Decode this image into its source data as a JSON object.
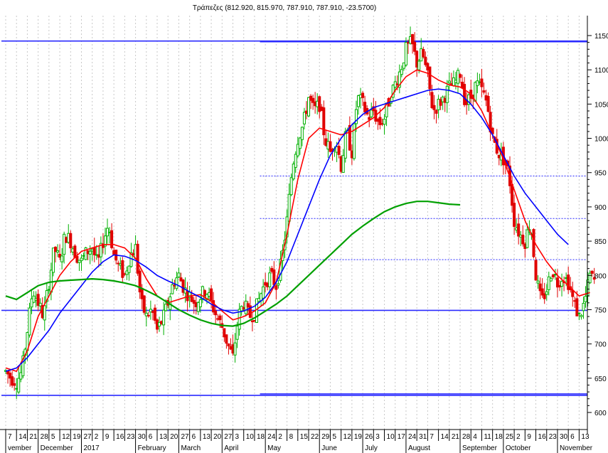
{
  "title": "Τράπεζες (812.920, 815.970, 787.910, 787.910, -23.5700)",
  "chart_data": {
    "type": "candlestick",
    "title": "Τράπεζες (812.920, 815.970, 787.910, 787.910, -23.5700)",
    "ohlc_last": {
      "open": 812.92,
      "high": 815.97,
      "low": 787.91,
      "close": 787.91,
      "change": -23.57
    },
    "ylim": [
      585,
      1165
    ],
    "y_ticks": [
      600,
      650,
      700,
      750,
      800,
      850,
      900,
      950,
      1000,
      1050,
      1100,
      1150
    ],
    "grid": true,
    "x_day_labels": [
      "7",
      "14",
      "21",
      "28",
      "5",
      "12",
      "19",
      "27",
      "2",
      "9",
      "16",
      "23",
      "30",
      "6",
      "13",
      "20",
      "27",
      "6",
      "13",
      "20",
      "27",
      "3",
      "10",
      "18",
      "24",
      "2",
      "8",
      "15",
      "22",
      "29",
      "5",
      "12",
      "19",
      "26",
      "3",
      "10",
      "17",
      "24",
      "31",
      "7",
      "14",
      "21",
      "28",
      "4",
      "11",
      "18",
      "25",
      "2",
      "9",
      "16",
      "23",
      "30",
      "6",
      "13"
    ],
    "x_month_labels": [
      {
        "label": "vember",
        "after_day_index": 0
      },
      {
        "label": "December",
        "after_day_index": 3
      },
      {
        "label": "2017",
        "after_day_index": 7
      },
      {
        "label": "February",
        "after_day_index": 12
      },
      {
        "label": "March",
        "after_day_index": 16
      },
      {
        "label": "April",
        "after_day_index": 20
      },
      {
        "label": "May",
        "after_day_index": 24
      },
      {
        "label": "June",
        "after_day_index": 29
      },
      {
        "label": "July",
        "after_day_index": 33
      },
      {
        "label": "August",
        "after_day_index": 37
      },
      {
        "label": "September",
        "after_day_index": 42
      },
      {
        "label": "October",
        "after_day_index": 46
      },
      {
        "label": "November",
        "after_day_index": 51
      }
    ],
    "horizontal_levels": [
      {
        "value": 1142,
        "style": "solid",
        "start_week": 0
      },
      {
        "value": 1141,
        "style": "solid",
        "start_week": 23.5
      },
      {
        "value": 945,
        "style": "dotted",
        "start_week": 23.5
      },
      {
        "value": 883,
        "style": "dotted",
        "start_week": 23.5
      },
      {
        "value": 823,
        "style": "dotted",
        "start_week": 23.5
      },
      {
        "value": 749,
        "style": "solid",
        "start_week": 0
      },
      {
        "value": 625,
        "style": "solid",
        "start_week": 0
      },
      {
        "value": 627,
        "style": "solid",
        "start_week": 23.5
      }
    ],
    "candle_anchors": [
      [
        0,
        660
      ],
      [
        0.5,
        650
      ],
      [
        1,
        645
      ],
      [
        1.5,
        660
      ],
      [
        2,
        720
      ],
      [
        2.5,
        780
      ],
      [
        3,
        760
      ],
      [
        3.5,
        740
      ],
      [
        4,
        790
      ],
      [
        4.5,
        840
      ],
      [
        5,
        820
      ],
      [
        5.5,
        860
      ],
      [
        6,
        850
      ],
      [
        6.5,
        830
      ],
      [
        7,
        820
      ],
      [
        7.5,
        835
      ],
      [
        8,
        840
      ],
      [
        8.5,
        815
      ],
      [
        9,
        850
      ],
      [
        9.5,
        875
      ],
      [
        10,
        830
      ],
      [
        10.5,
        810
      ],
      [
        11,
        800
      ],
      [
        11.5,
        830
      ],
      [
        12,
        840
      ],
      [
        12.5,
        760
      ],
      [
        13,
        740
      ],
      [
        13.5,
        750
      ],
      [
        14,
        720
      ],
      [
        14.5,
        735
      ],
      [
        15,
        760
      ],
      [
        15.5,
        790
      ],
      [
        16,
        800
      ],
      [
        16.5,
        780
      ],
      [
        17,
        770
      ],
      [
        17.5,
        760
      ],
      [
        18,
        770
      ],
      [
        18.5,
        780
      ],
      [
        19,
        760
      ],
      [
        19.5,
        740
      ],
      [
        20,
        725
      ],
      [
        20.5,
        700
      ],
      [
        21,
        680
      ],
      [
        21.5,
        740
      ],
      [
        22,
        760
      ],
      [
        22.5,
        740
      ],
      [
        23,
        745
      ],
      [
        23.5,
        770
      ],
      [
        24,
        790
      ],
      [
        24.5,
        800
      ],
      [
        25,
        785
      ],
      [
        25.5,
        820
      ],
      [
        26,
        880
      ],
      [
        26.5,
        960
      ],
      [
        27,
        1000
      ],
      [
        27.5,
        1020
      ],
      [
        28,
        1060
      ],
      [
        28.5,
        1040
      ],
      [
        29,
        1050
      ],
      [
        29.5,
        1000
      ],
      [
        30,
        980
      ],
      [
        30.5,
        1000
      ],
      [
        31,
        960
      ],
      [
        31.5,
        1010
      ],
      [
        32,
        980
      ],
      [
        32.5,
        1060
      ],
      [
        33,
        1050
      ],
      [
        33.5,
        1030
      ],
      [
        34,
        1040
      ],
      [
        34.5,
        1020
      ],
      [
        35,
        1030
      ],
      [
        35.5,
        1060
      ],
      [
        36,
        1080
      ],
      [
        36.5,
        1100
      ],
      [
        37,
        1130
      ],
      [
        37.5,
        1140
      ],
      [
        38,
        1110
      ],
      [
        38.5,
        1125
      ],
      [
        39,
        1090
      ],
      [
        39.5,
        1040
      ],
      [
        40,
        1050
      ],
      [
        40.5,
        1060
      ],
      [
        41,
        1075
      ],
      [
        41.5,
        1080
      ],
      [
        42,
        1095
      ],
      [
        42.5,
        1050
      ],
      [
        43,
        1060
      ],
      [
        43.5,
        1080
      ],
      [
        44,
        1070
      ],
      [
        44.5,
        1050
      ],
      [
        45,
        1000
      ],
      [
        45.5,
        980
      ],
      [
        46,
        970
      ],
      [
        46.5,
        950
      ],
      [
        47,
        880
      ],
      [
        47.5,
        860
      ],
      [
        48,
        850
      ],
      [
        48.5,
        880
      ],
      [
        49,
        800
      ],
      [
        49.5,
        760
      ],
      [
        50,
        780
      ],
      [
        50.5,
        810
      ],
      [
        51,
        790
      ],
      [
        51.5,
        800
      ],
      [
        52,
        790
      ],
      [
        52.5,
        760
      ],
      [
        53,
        740
      ],
      [
        53.5,
        760
      ],
      [
        54,
        800
      ],
      [
        54.5,
        790
      ]
    ],
    "series": [
      {
        "name": "",
        "color": "#ff0000",
        "points": [
          [
            0,
            665
          ],
          [
            1,
            660
          ],
          [
            2,
            690
          ],
          [
            3,
            740
          ],
          [
            4,
            770
          ],
          [
            5,
            800
          ],
          [
            6,
            820
          ],
          [
            7,
            835
          ],
          [
            8,
            840
          ],
          [
            9,
            845
          ],
          [
            10,
            845
          ],
          [
            11,
            840
          ],
          [
            12,
            825
          ],
          [
            13,
            795
          ],
          [
            14,
            770
          ],
          [
            15,
            760
          ],
          [
            16,
            765
          ],
          [
            17,
            770
          ],
          [
            18,
            772
          ],
          [
            19,
            762
          ],
          [
            20,
            748
          ],
          [
            21,
            735
          ],
          [
            22,
            740
          ],
          [
            23,
            748
          ],
          [
            24,
            760
          ],
          [
            25,
            790
          ],
          [
            26,
            860
          ],
          [
            27,
            940
          ],
          [
            28,
            1000
          ],
          [
            29,
            1015
          ],
          [
            30,
            1010
          ],
          [
            31,
            1005
          ],
          [
            32,
            1010
          ],
          [
            33,
            1020
          ],
          [
            34,
            1030
          ],
          [
            35,
            1045
          ],
          [
            36,
            1070
          ],
          [
            37,
            1090
          ],
          [
            38,
            1100
          ],
          [
            39,
            1095
          ],
          [
            40,
            1085
          ],
          [
            41,
            1078
          ],
          [
            42,
            1075
          ],
          [
            43,
            1065
          ],
          [
            44,
            1040
          ],
          [
            45,
            1005
          ],
          [
            46,
            970
          ],
          [
            47,
            925
          ],
          [
            48,
            880
          ],
          [
            49,
            845
          ],
          [
            50,
            820
          ],
          [
            51,
            800
          ],
          [
            52,
            785
          ],
          [
            53,
            770
          ],
          [
            54,
            775
          ]
        ]
      },
      {
        "name": "",
        "color": "#0000ff",
        "points": [
          [
            0,
            660
          ],
          [
            1,
            665
          ],
          [
            2,
            680
          ],
          [
            3,
            700
          ],
          [
            4,
            720
          ],
          [
            5,
            745
          ],
          [
            6,
            765
          ],
          [
            7,
            785
          ],
          [
            8,
            805
          ],
          [
            9,
            820
          ],
          [
            10,
            830
          ],
          [
            11,
            828
          ],
          [
            12,
            822
          ],
          [
            13,
            812
          ],
          [
            14,
            800
          ],
          [
            15,
            792
          ],
          [
            16,
            785
          ],
          [
            17,
            776
          ],
          [
            18,
            768
          ],
          [
            19,
            758
          ],
          [
            20,
            750
          ],
          [
            21,
            745
          ],
          [
            22,
            748
          ],
          [
            23,
            755
          ],
          [
            24,
            768
          ],
          [
            25,
            790
          ],
          [
            26,
            820
          ],
          [
            27,
            860
          ],
          [
            28,
            900
          ],
          [
            29,
            940
          ],
          [
            30,
            975
          ],
          [
            31,
            1000
          ],
          [
            32,
            1020
          ],
          [
            33,
            1035
          ],
          [
            34,
            1045
          ],
          [
            35,
            1050
          ],
          [
            36,
            1055
          ],
          [
            37,
            1060
          ],
          [
            38,
            1065
          ],
          [
            39,
            1070
          ],
          [
            40,
            1072
          ],
          [
            41,
            1070
          ],
          [
            42,
            1065
          ],
          [
            43,
            1050
          ],
          [
            44,
            1030
          ],
          [
            45,
            1005
          ],
          [
            46,
            975
          ],
          [
            47,
            945
          ],
          [
            48,
            920
          ],
          [
            49,
            900
          ],
          [
            50,
            880
          ],
          [
            51,
            860
          ],
          [
            52,
            845
          ]
        ]
      },
      {
        "name": "",
        "color": "#00a000",
        "points": [
          [
            0,
            770
          ],
          [
            1,
            765
          ],
          [
            2,
            775
          ],
          [
            3,
            785
          ],
          [
            4,
            790
          ],
          [
            5,
            792
          ],
          [
            6,
            793
          ],
          [
            7,
            794
          ],
          [
            8,
            795
          ],
          [
            9,
            794
          ],
          [
            10,
            792
          ],
          [
            11,
            789
          ],
          [
            12,
            785
          ],
          [
            13,
            778
          ],
          [
            14,
            770
          ],
          [
            15,
            760
          ],
          [
            16,
            750
          ],
          [
            17,
            742
          ],
          [
            18,
            735
          ],
          [
            19,
            730
          ],
          [
            20,
            727
          ],
          [
            21,
            726
          ],
          [
            22,
            730
          ],
          [
            23,
            738
          ],
          [
            24,
            748
          ],
          [
            25,
            758
          ],
          [
            26,
            770
          ],
          [
            27,
            785
          ],
          [
            28,
            800
          ],
          [
            29,
            815
          ],
          [
            30,
            830
          ],
          [
            31,
            845
          ],
          [
            32,
            860
          ],
          [
            33,
            872
          ],
          [
            34,
            883
          ],
          [
            35,
            893
          ],
          [
            36,
            900
          ],
          [
            37,
            905
          ],
          [
            38,
            908
          ],
          [
            39,
            908
          ],
          [
            40,
            906
          ],
          [
            41,
            904
          ],
          [
            42,
            903
          ]
        ]
      }
    ]
  }
}
